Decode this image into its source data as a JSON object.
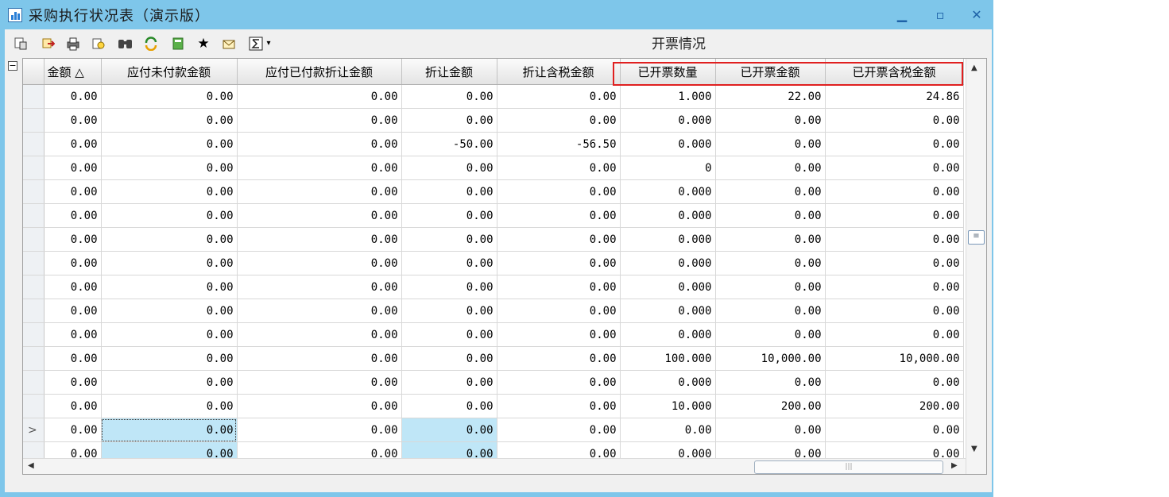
{
  "window": {
    "title": "采购执行状况表（演示版）",
    "minimize_glyph": "▁",
    "maximize_glyph": "▫",
    "close_glyph": "✕"
  },
  "toolbar": {
    "icons": [
      "preview-icon",
      "export-icon",
      "print-icon",
      "filter-icon",
      "find-icon",
      "refresh-icon",
      "save-icon",
      "favorite-icon",
      "mail-icon",
      "sum-icon",
      "dropdown-icon"
    ],
    "annotation_label": "开票情况"
  },
  "grid": {
    "columns": [
      "金额 △",
      "应付未付款金额",
      "应付已付款折让金额",
      "折让金额",
      "折让含税金额",
      "已开票数量",
      "已开票金额",
      "已开票含税金额"
    ],
    "rows": [
      [
        "0.00",
        "0.00",
        "0.00",
        "0.00",
        "0.00",
        "1.000",
        "22.00",
        "24.86"
      ],
      [
        "0.00",
        "0.00",
        "0.00",
        "0.00",
        "0.00",
        "0.000",
        "0.00",
        "0.00"
      ],
      [
        "0.00",
        "0.00",
        "0.00",
        "-50.00",
        "-56.50",
        "0.000",
        "0.00",
        "0.00"
      ],
      [
        "0.00",
        "0.00",
        "0.00",
        "0.00",
        "0.00",
        "0",
        "0.00",
        "0.00"
      ],
      [
        "0.00",
        "0.00",
        "0.00",
        "0.00",
        "0.00",
        "0.000",
        "0.00",
        "0.00"
      ],
      [
        "0.00",
        "0.00",
        "0.00",
        "0.00",
        "0.00",
        "0.000",
        "0.00",
        "0.00"
      ],
      [
        "0.00",
        "0.00",
        "0.00",
        "0.00",
        "0.00",
        "0.000",
        "0.00",
        "0.00"
      ],
      [
        "0.00",
        "0.00",
        "0.00",
        "0.00",
        "0.00",
        "0.000",
        "0.00",
        "0.00"
      ],
      [
        "0.00",
        "0.00",
        "0.00",
        "0.00",
        "0.00",
        "0.000",
        "0.00",
        "0.00"
      ],
      [
        "0.00",
        "0.00",
        "0.00",
        "0.00",
        "0.00",
        "0.000",
        "0.00",
        "0.00"
      ],
      [
        "0.00",
        "0.00",
        "0.00",
        "0.00",
        "0.00",
        "0.000",
        "0.00",
        "0.00"
      ],
      [
        "0.00",
        "0.00",
        "0.00",
        "0.00",
        "0.00",
        "100.000",
        "10,000.00",
        "10,000.00"
      ],
      [
        "0.00",
        "0.00",
        "0.00",
        "0.00",
        "0.00",
        "0.000",
        "0.00",
        "0.00"
      ],
      [
        "0.00",
        "0.00",
        "0.00",
        "0.00",
        "0.00",
        "10.000",
        "200.00",
        "200.00"
      ],
      [
        "0.00",
        "0.00",
        "0.00",
        "0.00",
        "0.00",
        "0.00",
        "0.00",
        "0.00"
      ],
      [
        "0.00",
        "0.00",
        "0.00",
        "0.00",
        "0.00",
        "0.000",
        "0.00",
        "0.00"
      ]
    ],
    "current_row_index": 14,
    "current_row_marker": ">",
    "highlighted_columns": [
      1,
      3
    ],
    "highlight_color": "#bfe6f7",
    "annotation_box_color": "#e02020"
  },
  "scrollbars": {
    "v_up": "▲",
    "v_down": "▼",
    "v_thumb": "≡",
    "h_left": "◀",
    "h_right": "▶",
    "h_thumb": "|||"
  }
}
